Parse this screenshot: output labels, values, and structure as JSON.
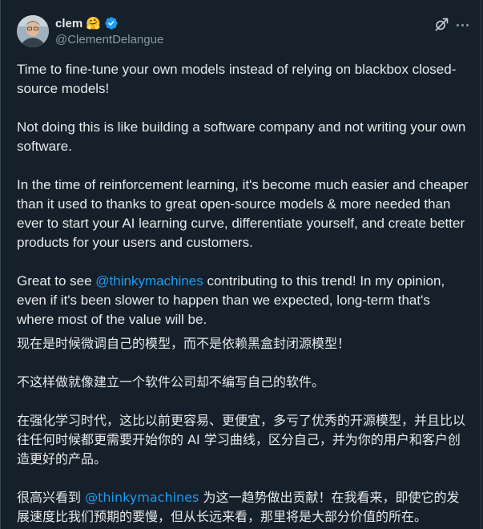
{
  "author": {
    "display_name": "clem",
    "emoji": "🤗",
    "handle": "@ClementDelangue"
  },
  "colors": {
    "background": "#15202b",
    "text": "#e7e9ea",
    "secondary": "#8b98a5",
    "accent": "#1d9bf0"
  },
  "icons": {
    "verified": "verified-badge-icon",
    "grok": "grok-icon",
    "more": "more-options-icon"
  },
  "post": {
    "p1": "Time to fine-tune your own models instead of relying on blackbox closed-source models!",
    "p2": "Not doing this is like building a software company and not writing your own software.",
    "p3": "In the time of reinforcement learning, it's become much easier and cheaper than it used to thanks to great open-source models & more needed than ever to start your AI learning curve, differentiate yourself, and create better products for your users and customers.",
    "p4_before": "Great to see ",
    "p4_mention": "@thinkymachines",
    "p4_after": " contributing to this trend! In my opinion, even if it's been slower to happen than we expected, long-term that's where most of the value will be."
  },
  "translation": {
    "p1": "现在是时候微调自己的模型，而不是依赖黑盒封闭源模型！",
    "p2": "不这样做就像建立一个软件公司却不编写自己的软件。",
    "p3": "在强化学习时代，这比以前更容易、更便宜，多亏了优秀的开源模型，并且比以往任何时候都更需要开始你的 AI 学习曲线，区分自己，并为你的用户和客户创造更好的产品。",
    "p4_before": "很高兴看到 ",
    "p4_mention": "@thinkymachines",
    "p4_after": " 为这一趋势做出贡献！在我看来，即使它的发展速度比我们预期的要慢，但从长远来看，那里将是大部分价值的所在。"
  }
}
